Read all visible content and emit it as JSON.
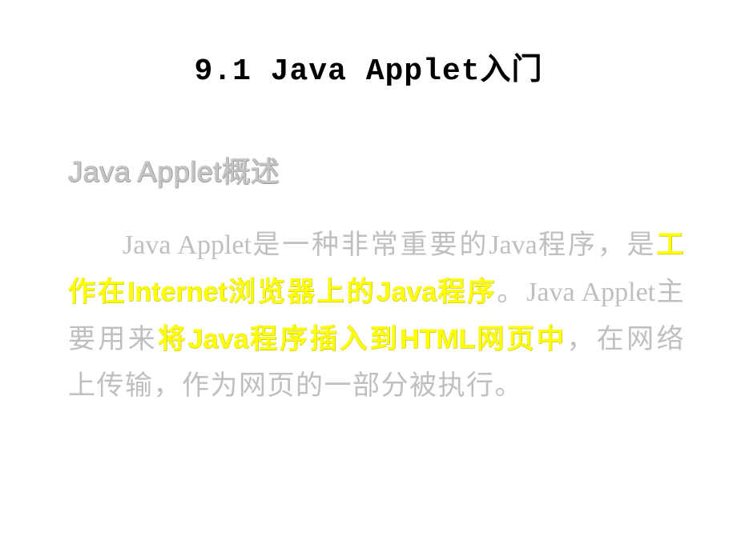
{
  "title": "9.1 Java Applet入门",
  "subtitle_en": "Java Applet",
  "subtitle_cn": "概述",
  "body": {
    "p1_pre": "Java Applet",
    "p1_a": "是一种非常重要的",
    "p1_java": "Java",
    "p1_b": "程序，是",
    "hl1_pre": "工作在",
    "hl1_internet": "Internet",
    "hl1_mid": "浏览器上的",
    "hl1_java": "Java",
    "hl1_post": "程序",
    "p1_c": "。",
    "p1_java2": "Java Applet",
    "p1_d": "主要用来",
    "hl2_pre": "将",
    "hl2_java": "Java",
    "hl2_mid": "程序插入到",
    "hl2_html": "HTML",
    "hl2_post": "网页中",
    "p1_e": "，在网络上传输，作为网页的一部分被执行。"
  },
  "watermark": ""
}
